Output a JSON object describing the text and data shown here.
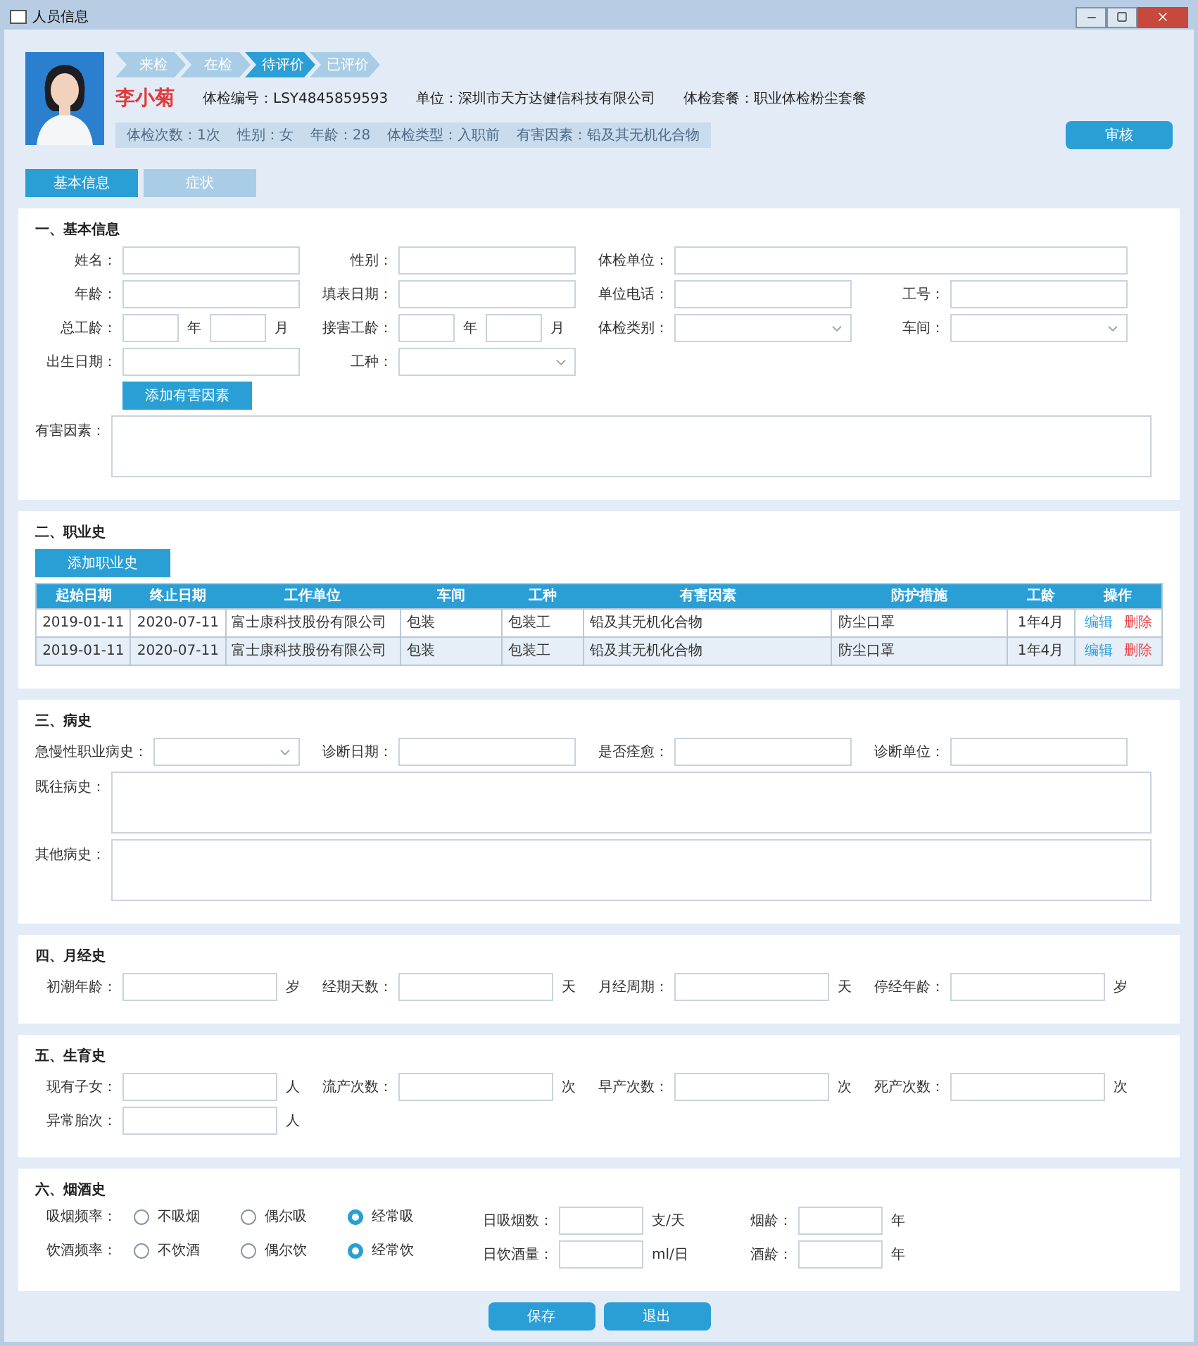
{
  "window": {
    "title": "人员信息"
  },
  "steps": [
    {
      "label": "来检",
      "selected": false
    },
    {
      "label": "在检",
      "selected": false
    },
    {
      "label": "待评价",
      "selected": true
    },
    {
      "label": "已评价",
      "selected": false
    }
  ],
  "person": {
    "name": "李小菊",
    "info": [
      "体检编号：LSY4845859593",
      "单位：深圳市天方达健信科技有限公司",
      "体检套餐：职业体检粉尘套餐"
    ],
    "details": [
      "体检次数：1次",
      "性别：女",
      "年龄：28",
      "体检类型：入职前",
      "有害因素：铅及其无机化合物"
    ]
  },
  "review_button": "审核",
  "tabs": [
    {
      "label": "基本信息",
      "selected": true
    },
    {
      "label": "症状",
      "selected": false
    }
  ],
  "sections": [
    {
      "title": "一、基本信息",
      "rows": [
        {
          "items": [
            {
              "kind": "input",
              "label": "姓名："
            },
            {
              "kind": "input",
              "label": "性别："
            },
            {
              "kind": "input_wide",
              "label": "体检单位："
            }
          ]
        },
        {
          "items": [
            {
              "kind": "input",
              "label": "年龄："
            },
            {
              "kind": "input",
              "label": "填表日期："
            },
            {
              "kind": "input",
              "label": "单位电话："
            },
            {
              "kind": "input",
              "label": "工号："
            }
          ]
        },
        {
          "items": [
            {
              "kind": "year_month",
              "label": "总工龄：",
              "units": [
                "年",
                "月"
              ]
            },
            {
              "kind": "year_month",
              "label": "接害工龄：",
              "units": [
                "年",
                "月"
              ]
            },
            {
              "kind": "select",
              "label": "体检类别："
            },
            {
              "kind": "select",
              "label": "车间："
            }
          ]
        },
        {
          "items": [
            {
              "kind": "input",
              "label": "出生日期："
            },
            {
              "kind": "select",
              "label": "工种："
            }
          ]
        },
        {
          "items": [
            {
              "kind": "button",
              "label": "添加有害因素"
            }
          ]
        },
        {
          "items": [
            {
              "kind": "textarea",
              "label": "有害因素："
            }
          ]
        }
      ]
    },
    {
      "title": "二、职业史",
      "button": "添加职业史",
      "table": {
        "columns": [
          "起始日期",
          "终止日期",
          "工作单位",
          "车间",
          "工种",
          "有害因素",
          "防护措施",
          "工龄",
          "操作"
        ],
        "rows": [
          {
            "cells": [
              "2019-01-11",
              "2020-07-11",
              "富士康科技股份有限公司",
              "包装",
              "包装工",
              "铅及其无机化合物",
              "防尘口罩",
              "1年4月"
            ],
            "actions": [
              {
                "kind": "edit",
                "label": "编辑"
              },
              {
                "kind": "delete",
                "label": "删除"
              }
            ]
          },
          {
            "cells": [
              "2019-01-11",
              "2020-07-11",
              "富士康科技股份有限公司",
              "包装",
              "包装工",
              "铅及其无机化合物",
              "防尘口罩",
              "1年4月"
            ],
            "actions": [
              {
                "kind": "edit",
                "label": "编辑"
              },
              {
                "kind": "delete",
                "label": "删除"
              }
            ]
          }
        ]
      }
    },
    {
      "title": "三、病史",
      "rows": [
        {
          "items": [
            {
              "kind": "select",
              "label": "急慢性职业病史："
            },
            {
              "kind": "input",
              "label": "诊断日期："
            },
            {
              "kind": "input",
              "label": "是否痊愈："
            },
            {
              "kind": "input",
              "label": "诊断单位："
            }
          ]
        },
        {
          "items": [
            {
              "kind": "textarea",
              "label": "既往病史："
            }
          ]
        },
        {
          "items": [
            {
              "kind": "textarea",
              "label": "其他病史："
            }
          ]
        }
      ]
    },
    {
      "title": "四、月经史",
      "rows": [
        {
          "items": [
            {
              "kind": "input",
              "label": "初潮年龄：",
              "unit": "岁"
            },
            {
              "kind": "input",
              "label": "经期天数：",
              "unit": "天"
            },
            {
              "kind": "input",
              "label": "月经周期：",
              "unit": "天"
            },
            {
              "kind": "input",
              "label": "停经年龄：",
              "unit": "岁"
            }
          ]
        }
      ]
    },
    {
      "title": "五、生育史",
      "rows": [
        {
          "items": [
            {
              "kind": "input",
              "label": "现有子女：",
              "unit": "人"
            },
            {
              "kind": "input",
              "label": "流产次数：",
              "unit": "次"
            },
            {
              "kind": "input",
              "label": "早产次数：",
              "unit": "次"
            },
            {
              "kind": "input",
              "label": "死产次数：",
              "unit": "次"
            }
          ]
        },
        {
          "items": [
            {
              "kind": "input",
              "label": "异常胎次：",
              "unit": "人"
            }
          ]
        }
      ]
    },
    {
      "title": "六、烟酒史",
      "rows": [
        {
          "items": [
            {
              "kind": "radio",
              "label": "吸烟频率：",
              "options": [
                {
                  "label": "不吸烟",
                  "selected": false
                },
                {
                  "label": "偶尔吸",
                  "selected": false
                },
                {
                  "label": "经常吸",
                  "selected": true
                }
              ]
            },
            {
              "kind": "input_short",
              "label": "日吸烟数：",
              "unit": "支/天"
            },
            {
              "kind": "input_short",
              "label": "烟龄：",
              "unit": "年"
            }
          ]
        },
        {
          "items": [
            {
              "kind": "radio",
              "label": "饮酒频率：",
              "options": [
                {
                  "label": "不饮酒",
                  "selected": false
                },
                {
                  "label": "偶尔饮",
                  "selected": false
                },
                {
                  "label": "经常饮",
                  "selected": true
                }
              ]
            },
            {
              "kind": "input_short",
              "label": "日饮酒量：",
              "unit": "ml/日"
            },
            {
              "kind": "input_short",
              "label": "酒龄：",
              "unit": "年"
            }
          ]
        }
      ]
    }
  ],
  "footer_buttons": [
    "保存",
    "退出"
  ]
}
